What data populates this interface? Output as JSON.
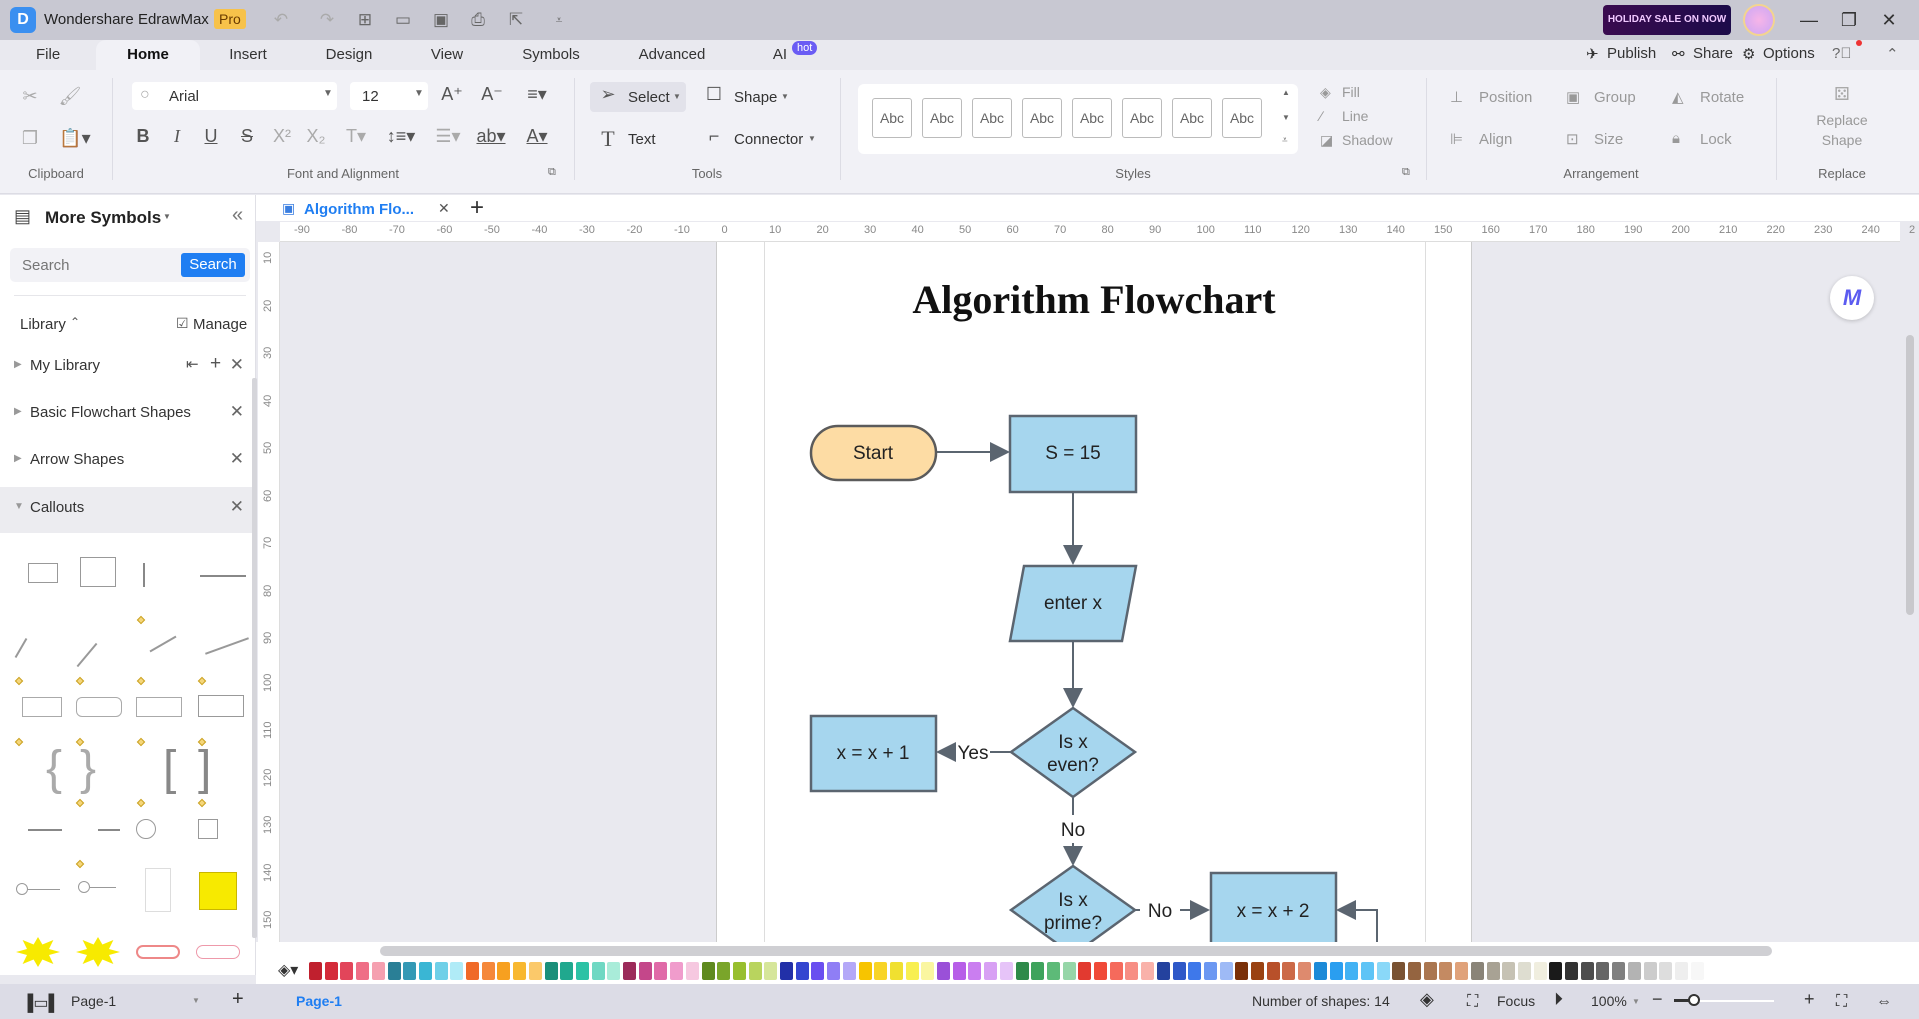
{
  "app": {
    "title": "Wondershare EdrawMax",
    "badge": "Pro",
    "promo": "HOLIDAY SALE ON NOW"
  },
  "menu": {
    "tabs": [
      {
        "label": "File"
      },
      {
        "label": "Home"
      },
      {
        "label": "Insert"
      },
      {
        "label": "Design"
      },
      {
        "label": "View"
      },
      {
        "label": "Symbols"
      },
      {
        "label": "Advanced"
      },
      {
        "label": "AI"
      }
    ],
    "ai_badge": "hot",
    "active_tab": "Home",
    "right": {
      "publish": "Publish",
      "share": "Share",
      "options": "Options"
    }
  },
  "ribbon": {
    "groups": {
      "clipboard": "Clipboard",
      "font": "Font and Alignment",
      "tools": "Tools",
      "styles": "Styles",
      "arrangement": "Arrangement",
      "replace": "Replace"
    },
    "font_family": "Arial",
    "font_size": "12",
    "tools": {
      "select": "Select",
      "shape": "Shape",
      "text": "Text",
      "connector": "Connector"
    },
    "style_samples": [
      "Abc",
      "Abc",
      "Abc",
      "Abc",
      "Abc",
      "Abc",
      "Abc",
      "Abc"
    ],
    "format": {
      "fill": "Fill",
      "line": "Line",
      "shadow": "Shadow"
    },
    "arrangement": {
      "position": "Position",
      "group": "Group",
      "rotate": "Rotate",
      "align": "Align",
      "size": "Size",
      "lock": "Lock"
    },
    "replace_shape": "Replace Shape"
  },
  "sidebar": {
    "title": "More Symbols",
    "search_placeholder": "Search",
    "search_button": "Search",
    "library_label": "Library",
    "manage_label": "Manage",
    "libraries": [
      {
        "label": "My Library",
        "expanded": false
      },
      {
        "label": "Basic Flowchart Shapes",
        "expanded": false
      },
      {
        "label": "Arrow Shapes",
        "expanded": false
      },
      {
        "label": "Callouts",
        "expanded": true
      }
    ]
  },
  "document": {
    "tab_title": "Algorithm Flo...",
    "hruler_ticks": [
      "-90",
      "-80",
      "-70",
      "-60",
      "-50",
      "-40",
      "-30",
      "-20",
      "-10",
      "0",
      "10",
      "20",
      "30",
      "40",
      "50",
      "60",
      "70",
      "80",
      "90",
      "100",
      "110",
      "120",
      "130",
      "140",
      "150",
      "160",
      "170",
      "180",
      "190",
      "200",
      "210",
      "220",
      "230",
      "240",
      "2"
    ],
    "vruler_ticks": [
      "10",
      "20",
      "30",
      "40",
      "50",
      "60",
      "70",
      "80",
      "90",
      "100",
      "110",
      "120",
      "130",
      "140",
      "150"
    ]
  },
  "diagram": {
    "title": "Algorithm Flowchart",
    "nodes": {
      "start": "Start",
      "assign_s": "S = 15",
      "input": "enter x",
      "even_q1": "Is x",
      "even_q2": "even?",
      "inc1": "x = x + 1",
      "prime_q1": "Is x",
      "prime_q2": "prime?",
      "inc2": "x = x + 2"
    },
    "edge_labels": {
      "yes": "Yes",
      "no_even": "No",
      "no_prime": "No"
    },
    "colors": {
      "process_fill": "#a6d6ee",
      "terminal_fill": "#fddca4",
      "stroke": "#5b6570"
    }
  },
  "palette": {
    "colors": [
      "#c0202e",
      "#d42b3a",
      "#e2455a",
      "#ef6e86",
      "#f5a0b0",
      "#2a7f96",
      "#3499b5",
      "#3ab6d4",
      "#6fd0e8",
      "#b0ebf7",
      "#f06a28",
      "#f5883a",
      "#f7a020",
      "#f8b830",
      "#fbc96a",
      "#1b8f7a",
      "#20a88e",
      "#2cc2a5",
      "#6fd8c3",
      "#a9ecd9",
      "#9c2a5a",
      "#c4478a",
      "#e06aa8",
      "#f09ccc",
      "#f6c8e0",
      "#5f8a1e",
      "#7aa52a",
      "#98bf2e",
      "#b9d45e",
      "#d6e69a",
      "#2230a8",
      "#3446d0",
      "#6a4ff0",
      "#8f7ef5",
      "#b4a8f8",
      "#f7c400",
      "#f8d426",
      "#f0e030",
      "#f8ef50",
      "#faf6a0",
      "#9a50d8",
      "#b75ee8",
      "#ca7ef0",
      "#d8a0f4",
      "#e6c4f8",
      "#2f8a4a",
      "#3ea35c",
      "#5dba78",
      "#96d6a8",
      "#e23a30",
      "#f04a38",
      "#f56a5c",
      "#f78e84",
      "#f9b2aa",
      "#24429e",
      "#2e58c8",
      "#3e78ea",
      "#6c98f2",
      "#9ebaf6",
      "#7a3008",
      "#9a4212",
      "#b8502a",
      "#cc6a48",
      "#de8a6e",
      "#1c8ad8",
      "#2a9ef0",
      "#42b2f4",
      "#5ec4f6",
      "#8ad8f8",
      "#7a5232",
      "#946440",
      "#aa7650",
      "#c48a62",
      "#e0a27a",
      "#8a8478",
      "#a8a294",
      "#c6c2b4",
      "#deddd0",
      "#f0eedf",
      "#1a1a1a",
      "#333333",
      "#4d4d4d",
      "#666666",
      "#808080",
      "#b3b3b3",
      "#cccccc",
      "#dddddd",
      "#eeeeee",
      "#f7f7f7"
    ]
  },
  "status": {
    "page_select": "Page-1",
    "page_tab": "Page-1",
    "shape_count": "Number of shapes: 14",
    "focus": "Focus",
    "zoom": "100%",
    "zoom_slider_fraction": 0.2
  }
}
